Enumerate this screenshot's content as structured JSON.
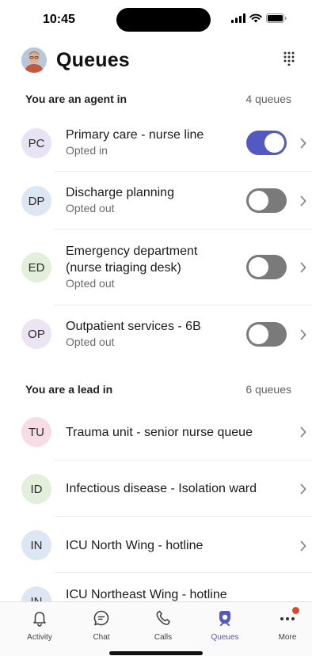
{
  "status_bar": {
    "time": "10:45"
  },
  "header": {
    "title": "Queues",
    "avatar_icon": "user-avatar",
    "dialpad_icon": "dialpad-icon"
  },
  "agent_section": {
    "title": "You are an agent in",
    "count": "4 queues"
  },
  "agent_queues": [
    {
      "initials": "PC",
      "name": "Primary care - nurse line",
      "status": "Opted in",
      "toggle_on": true,
      "avatar_color": "#e8e3f2"
    },
    {
      "initials": "DP",
      "name": "Discharge planning",
      "status": "Opted out",
      "toggle_on": false,
      "avatar_color": "#dde6f3"
    },
    {
      "initials": "ED",
      "name": "Emergency department",
      "name_line2": "(nurse triaging desk)",
      "status": "Opted out",
      "toggle_on": false,
      "avatar_color": "#e3eedb"
    },
    {
      "initials": "OP",
      "name": "Outpatient services - 6B",
      "status": "Opted out",
      "toggle_on": false,
      "avatar_color": "#ebe4f2"
    }
  ],
  "lead_section": {
    "title": "You are a lead in",
    "count": "6 queues"
  },
  "lead_queues": [
    {
      "initials": "TU",
      "name": "Trauma unit - senior nurse queue",
      "avatar_color": "#f6dde5"
    },
    {
      "initials": "ID",
      "name": "Infectious disease - Isolation ward",
      "avatar_color": "#e3eedb"
    },
    {
      "initials": "IN",
      "name": "ICU North Wing - hotline",
      "avatar_color": "#dde6f3"
    },
    {
      "initials": "IN",
      "name": "ICU Northeast Wing - hotline",
      "avatar_color": "#dde6f3"
    }
  ],
  "tabs": [
    {
      "label": "Activity",
      "icon": "bell-icon",
      "active": false
    },
    {
      "label": "Chat",
      "icon": "chat-icon",
      "active": false
    },
    {
      "label": "Calls",
      "icon": "phone-icon",
      "active": false
    },
    {
      "label": "Queues",
      "icon": "queues-icon",
      "active": true
    },
    {
      "label": "More",
      "icon": "more-icon",
      "active": false,
      "badge": true
    }
  ],
  "colors": {
    "accent": "#5359c2",
    "toggle_off": "#7a7a7a",
    "badge": "#e0472a"
  }
}
